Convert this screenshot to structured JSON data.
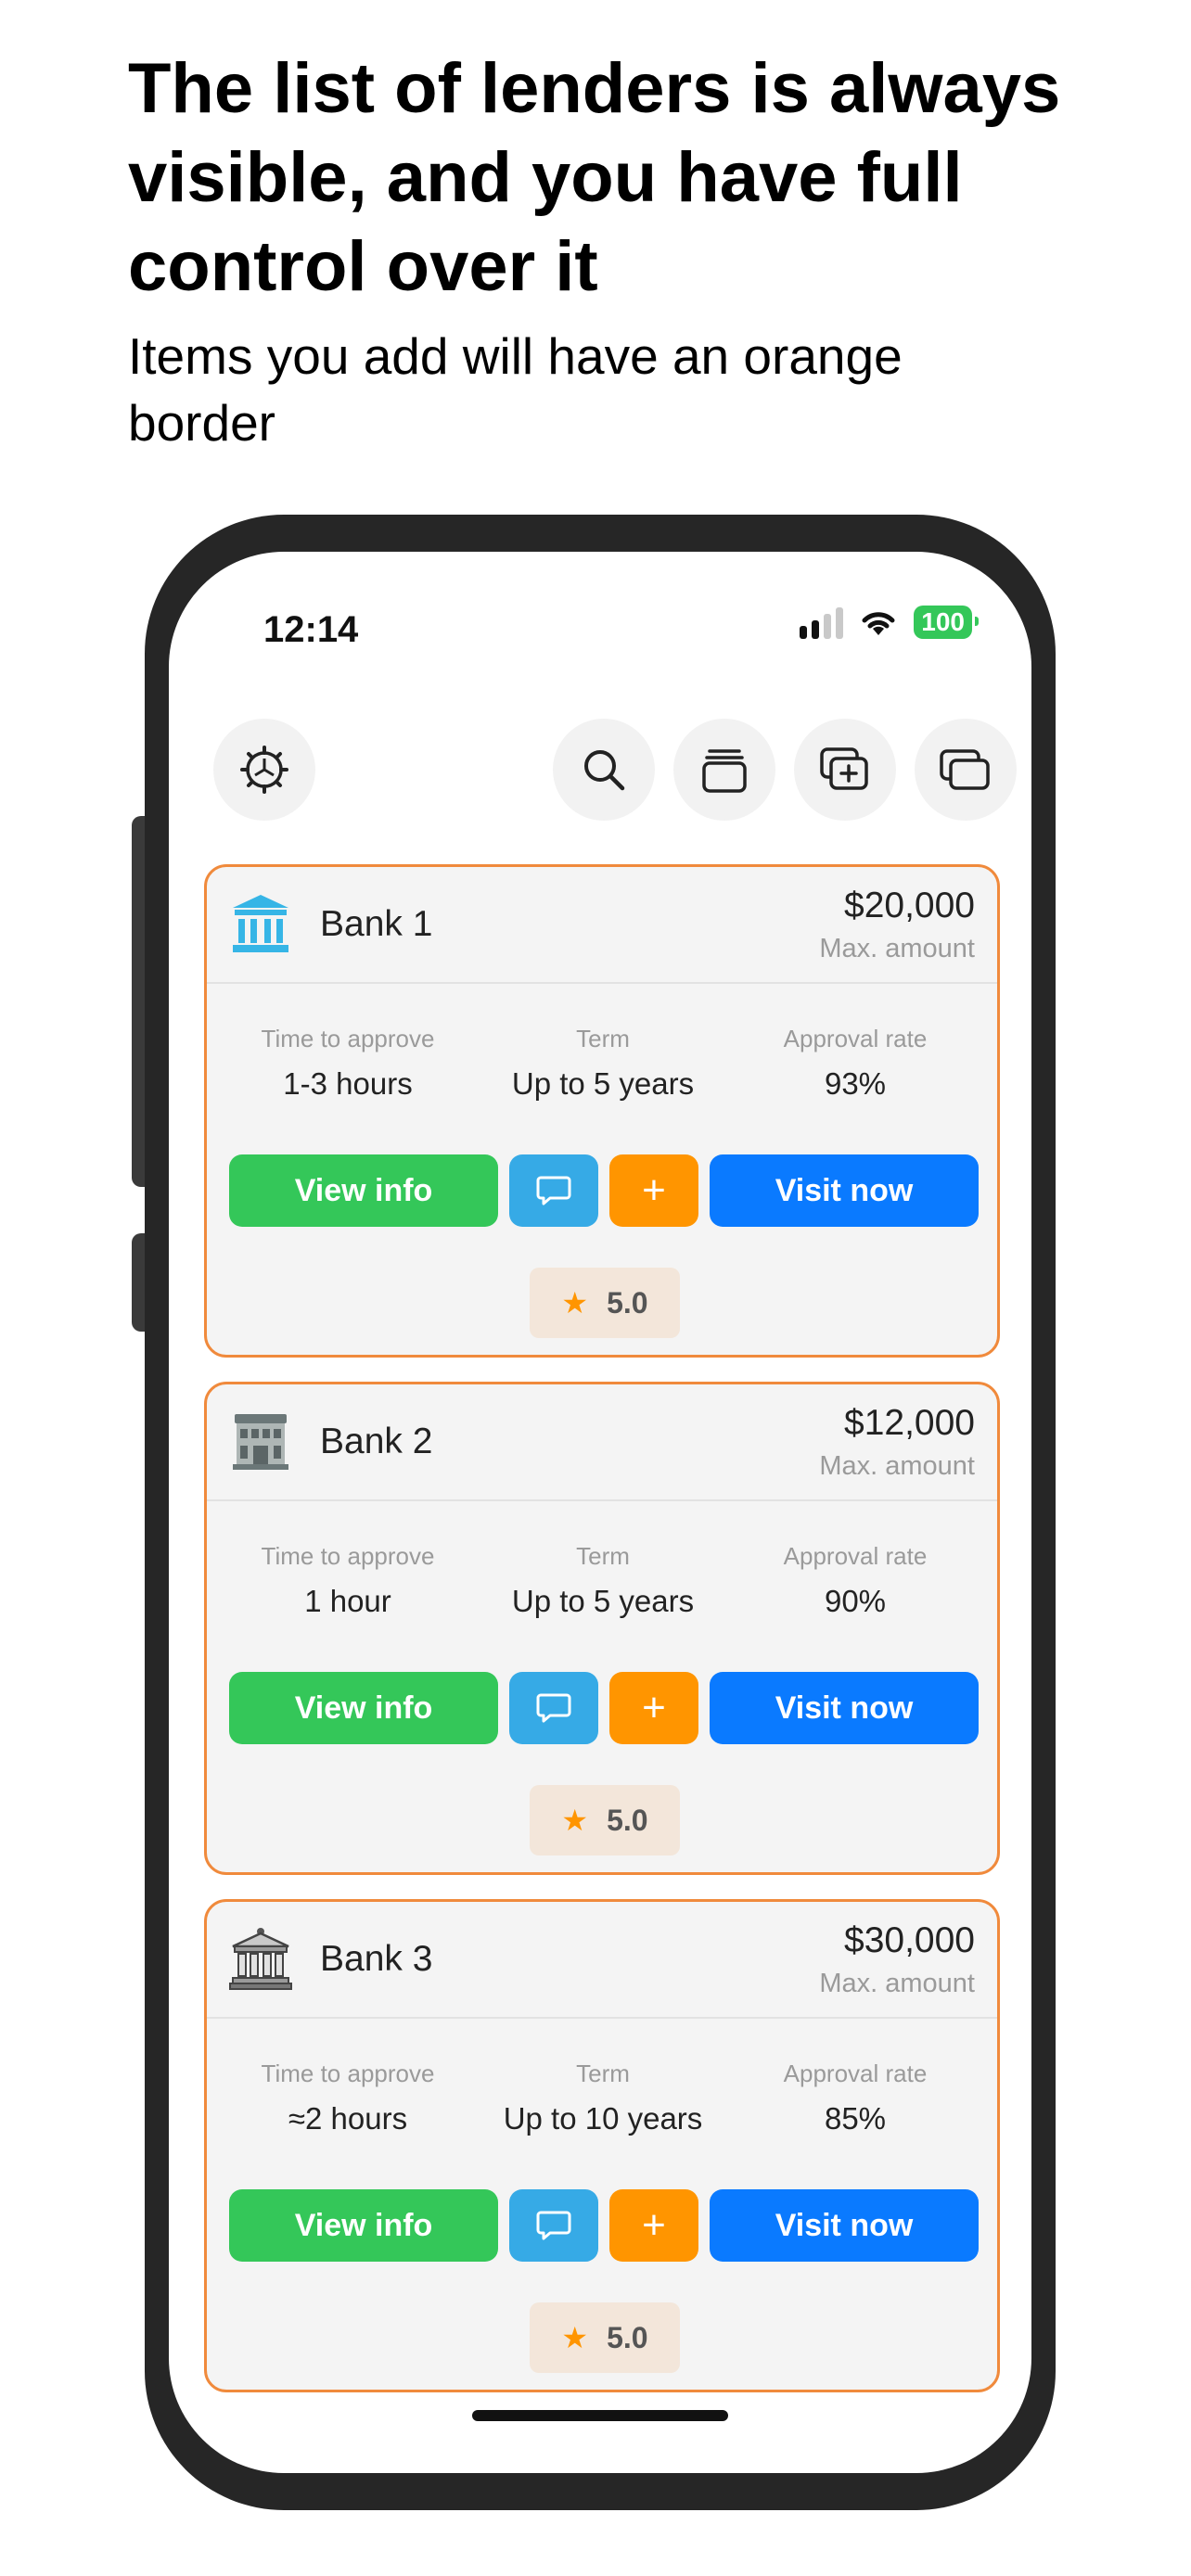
{
  "headline": "The list of lenders is always visible, and you have full control over it",
  "subheadline": "Items you add will have an orange border",
  "status_bar": {
    "time": "12:14",
    "battery": "100"
  },
  "toolbar": {
    "icons": [
      "settings-gear-icon",
      "search-icon",
      "stack-icon",
      "add-card-icon",
      "cards-icon"
    ]
  },
  "lenders": [
    {
      "name": "Bank 1",
      "amount": "$20,000",
      "amount_label": "Max. amount",
      "stats": [
        {
          "label": "Time to approve",
          "value": "1-3 hours"
        },
        {
          "label": "Term",
          "value": "Up to 5 years"
        },
        {
          "label": "Approval rate",
          "value": "93%"
        }
      ],
      "view_label": "View info",
      "add_label": "+",
      "visit_label": "Visit now",
      "rating": "5.0"
    },
    {
      "name": "Bank 2",
      "amount": "$12,000",
      "amount_label": "Max. amount",
      "stats": [
        {
          "label": "Time to approve",
          "value": "1 hour"
        },
        {
          "label": "Term",
          "value": "Up to 5 years"
        },
        {
          "label": "Approval rate",
          "value": "90%"
        }
      ],
      "view_label": "View info",
      "add_label": "+",
      "visit_label": "Visit now",
      "rating": "5.0"
    },
    {
      "name": "Bank 3",
      "amount": "$30,000",
      "amount_label": "Max. amount",
      "stats": [
        {
          "label": "Time to approve",
          "value": "≈2 hours"
        },
        {
          "label": "Term",
          "value": "Up to 10 years"
        },
        {
          "label": "Approval rate",
          "value": "85%"
        }
      ],
      "view_label": "View info",
      "add_label": "+",
      "visit_label": "Visit now",
      "rating": "5.0"
    }
  ],
  "colors": {
    "accent_border": "#f08a3c",
    "view_button": "#34c759",
    "chat_button": "#36aae6",
    "add_button": "#ff9500",
    "visit_button": "#0a7aff",
    "rating_bg": "#f3e6da",
    "star": "#ff9500"
  }
}
